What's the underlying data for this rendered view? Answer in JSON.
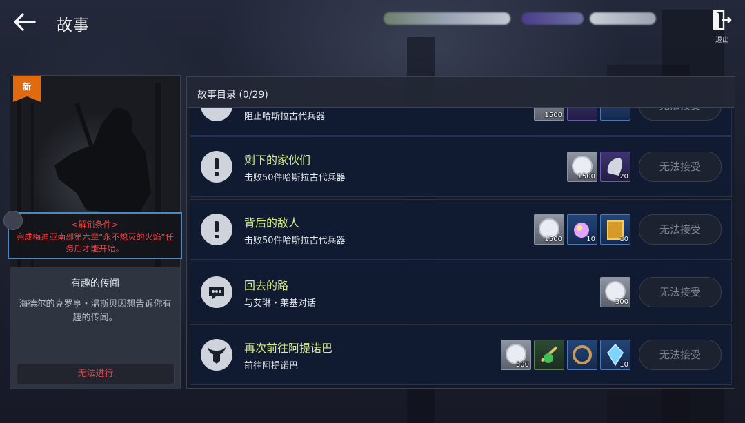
{
  "header": {
    "title": "故事",
    "exit_label": "退出"
  },
  "card": {
    "badge": "新",
    "unlock_title": "<解锁条件>",
    "unlock_text": "完成梅迪亚南部第六章“永不熄灭的火焰”任务后才能开始。",
    "name": "有趣的传闻",
    "description": "海德尔的克罗亨・温斯贝因想告诉你有趣的传闻。",
    "button": "无法进行"
  },
  "panel": {
    "title": "故事目录 (0/29)"
  },
  "quests": [
    {
      "name": "",
      "desc": "阻止哈斯拉古代兵器",
      "icon": "exclamation-icon",
      "rewards": [
        {
          "type": "silver-coin-icon",
          "qty": "1500"
        },
        {
          "type": "purple-item-icon",
          "qty": ""
        },
        {
          "type": "ring-icon",
          "qty": ""
        }
      ],
      "button": "无法接受"
    },
    {
      "name": "剩下的家伙们",
      "desc": "击败50件哈斯拉古代兵器",
      "icon": "exclamation-icon",
      "rewards": [
        {
          "type": "silver-coin-icon",
          "qty": "1500"
        },
        {
          "type": "stone-fragment-icon",
          "qty": "20"
        }
      ],
      "button": "无法接受"
    },
    {
      "name": "背后的敌人",
      "desc": "击败50件哈斯拉古代兵器",
      "icon": "exclamation-icon",
      "rewards": [
        {
          "type": "silver-coin-icon",
          "qty": "1500"
        },
        {
          "type": "orb-icon",
          "qty": "10"
        },
        {
          "type": "golden-chest-icon",
          "qty": "10"
        }
      ],
      "button": "无法接受"
    },
    {
      "name": "回去的路",
      "desc": "与艾琳・莱基对话",
      "icon": "chat-icon",
      "rewards": [
        {
          "type": "silver-coin-icon",
          "qty": "300"
        }
      ],
      "button": "无法接受"
    },
    {
      "name": "再次前往阿提诺巴",
      "desc": "前往阿提诺巴",
      "icon": "horned-helmet-icon",
      "rewards": [
        {
          "type": "silver-coin-icon",
          "qty": "300"
        },
        {
          "type": "herb-icon",
          "qty": ""
        },
        {
          "type": "ring-icon",
          "qty": ""
        },
        {
          "type": "crystal-icon",
          "qty": "10"
        }
      ],
      "button": "无法接受"
    }
  ],
  "colors": {
    "quest_name": "#d6ea86",
    "warning": "#ff3e3e",
    "accent_border": "#4a8ac2",
    "badge": "#e06a10"
  }
}
